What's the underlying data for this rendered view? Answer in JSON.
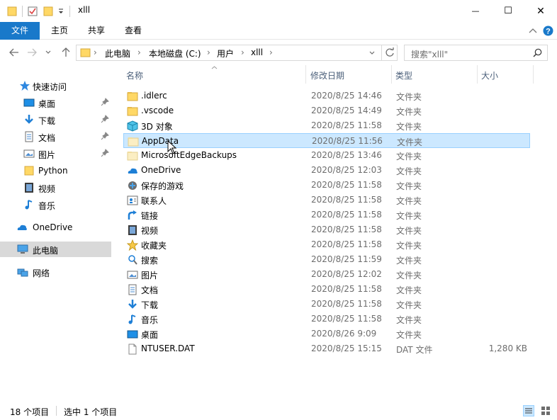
{
  "window": {
    "title": "xlll",
    "minimize_glyph": "—",
    "maximize_glyph": "☐",
    "close_glyph": "✕"
  },
  "ribbon": {
    "tabs": [
      "文件",
      "主页",
      "共享",
      "查看"
    ]
  },
  "address": {
    "crumbs": [
      "此电脑",
      "本地磁盘 (C:)",
      "用户",
      "xlll"
    ],
    "separator": "›"
  },
  "search": {
    "placeholder": "搜索\"xlll\""
  },
  "nav": {
    "quick_access": "快速访问",
    "pinned": [
      {
        "label": "桌面",
        "icon": "desktop-icon"
      },
      {
        "label": "下载",
        "icon": "download-icon"
      },
      {
        "label": "文档",
        "icon": "document-icon"
      },
      {
        "label": "图片",
        "icon": "picture-icon"
      }
    ],
    "recent": [
      {
        "label": "Python",
        "icon": "folder-icon"
      },
      {
        "label": "视频",
        "icon": "video-icon"
      },
      {
        "label": "音乐",
        "icon": "music-icon"
      }
    ],
    "onedrive": "OneDrive",
    "this_pc": "此电脑",
    "network": "网络"
  },
  "columns": {
    "name": "名称",
    "date": "修改日期",
    "type": "类型",
    "size": "大小"
  },
  "files": [
    {
      "name": ".idlerc",
      "date": "2020/8/25 14:46",
      "type": "文件夹",
      "size": "",
      "icon": "folder-icon"
    },
    {
      "name": ".vscode",
      "date": "2020/8/25 14:49",
      "type": "文件夹",
      "size": "",
      "icon": "folder-icon"
    },
    {
      "name": "3D 对象",
      "date": "2020/8/25 11:58",
      "type": "文件夹",
      "size": "",
      "icon": "3d-objects-icon"
    },
    {
      "name": "AppData",
      "date": "2020/8/25 11:56",
      "type": "文件夹",
      "size": "",
      "icon": "hidden-folder-icon",
      "selected": true
    },
    {
      "name": "MicrosoftEdgeBackups",
      "date": "2020/8/25 13:46",
      "type": "文件夹",
      "size": "",
      "icon": "hidden-folder-icon"
    },
    {
      "name": "OneDrive",
      "date": "2020/8/25 12:03",
      "type": "文件夹",
      "size": "",
      "icon": "onedrive-icon"
    },
    {
      "name": "保存的游戏",
      "date": "2020/8/25 11:58",
      "type": "文件夹",
      "size": "",
      "icon": "saved-games-icon"
    },
    {
      "name": "联系人",
      "date": "2020/8/25 11:58",
      "type": "文件夹",
      "size": "",
      "icon": "contacts-icon"
    },
    {
      "name": "链接",
      "date": "2020/8/25 11:58",
      "type": "文件夹",
      "size": "",
      "icon": "links-icon"
    },
    {
      "name": "视频",
      "date": "2020/8/25 11:58",
      "type": "文件夹",
      "size": "",
      "icon": "video-icon"
    },
    {
      "name": "收藏夹",
      "date": "2020/8/25 11:58",
      "type": "文件夹",
      "size": "",
      "icon": "favorites-icon"
    },
    {
      "name": "搜索",
      "date": "2020/8/25 11:59",
      "type": "文件夹",
      "size": "",
      "icon": "search-folder-icon"
    },
    {
      "name": "图片",
      "date": "2020/8/25 12:02",
      "type": "文件夹",
      "size": "",
      "icon": "picture-icon"
    },
    {
      "name": "文档",
      "date": "2020/8/25 11:58",
      "type": "文件夹",
      "size": "",
      "icon": "document-icon"
    },
    {
      "name": "下载",
      "date": "2020/8/25 11:58",
      "type": "文件夹",
      "size": "",
      "icon": "download-icon"
    },
    {
      "name": "音乐",
      "date": "2020/8/25 11:58",
      "type": "文件夹",
      "size": "",
      "icon": "music-icon"
    },
    {
      "name": "桌面",
      "date": "2020/8/26 9:09",
      "type": "文件夹",
      "size": "",
      "icon": "desktop-icon"
    },
    {
      "name": "NTUSER.DAT",
      "date": "2020/8/25 15:15",
      "type": "DAT 文件",
      "size": "1,280 KB",
      "icon": "file-icon"
    }
  ],
  "status": {
    "count": "18 个项目",
    "selected": "选中 1 个项目"
  },
  "colors": {
    "accent": "#1979ca",
    "folder": "#ffd866",
    "selection": "#cce8ff",
    "nav_selected": "#d9d9d9"
  }
}
